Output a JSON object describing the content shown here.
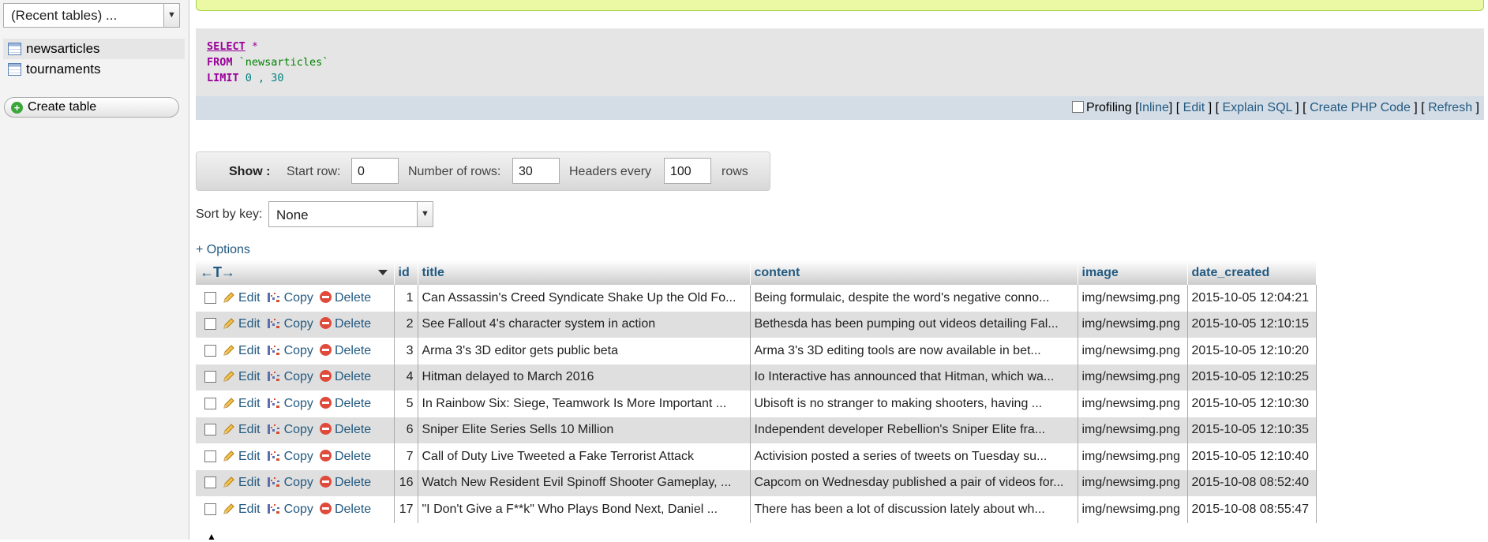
{
  "sidebar": {
    "recent_tables": "(Recent tables) ...",
    "tables": [
      {
        "name": "newsarticles"
      },
      {
        "name": "tournaments"
      }
    ],
    "create_table": "Create table"
  },
  "sql": {
    "select": "SELECT",
    "star": " *",
    "from": "FROM",
    "table": " `newsarticles`",
    "limit": "LIMIT",
    "offset": " 0",
    "sep": " , ",
    "count": "30"
  },
  "sql_actions": {
    "profiling": "Profiling",
    "inline": "Inline",
    "edit": "Edit",
    "explain": "Explain SQL",
    "php": "Create PHP Code",
    "refresh": "Refresh"
  },
  "nav": {
    "show_label": "Show :",
    "start_row_label": "Start row:",
    "start_row_value": "0",
    "num_rows_label": "Number of rows:",
    "num_rows_value": "30",
    "headers_every_label": "Headers every",
    "headers_every_value": "100",
    "rows_label": "rows"
  },
  "sort": {
    "label": "Sort by key:",
    "value": "None"
  },
  "options_link": "+ Options",
  "table": {
    "arrows": "←T→",
    "columns": [
      "id",
      "title",
      "content",
      "image",
      "date_created"
    ],
    "action_labels": {
      "edit": "Edit",
      "copy": "Copy",
      "delete": "Delete"
    },
    "rows": [
      {
        "id": "1",
        "title": "Can Assassin's Creed Syndicate Shake Up the Old Fo...",
        "content": "Being formulaic, despite the word's negative conno...",
        "image": "img/newsimg.png",
        "date_created": "2015-10-05 12:04:21"
      },
      {
        "id": "2",
        "title": "See Fallout 4's character system in action",
        "content": "Bethesda has been pumping out videos detailing Fal...",
        "image": "img/newsimg.png",
        "date_created": "2015-10-05 12:10:15"
      },
      {
        "id": "3",
        "title": "Arma 3's 3D editor gets public beta",
        "content": "Arma 3's 3D editing tools are now available in bet...",
        "image": "img/newsimg.png",
        "date_created": "2015-10-05 12:10:20"
      },
      {
        "id": "4",
        "title": "Hitman delayed to March 2016",
        "content": "Io Interactive has announced that Hitman, which wa...",
        "image": "img/newsimg.png",
        "date_created": "2015-10-05 12:10:25"
      },
      {
        "id": "5",
        "title": "In Rainbow Six: Siege, Teamwork Is More Important ...",
        "content": "Ubisoft is no stranger to making shooters, having ...",
        "image": "img/newsimg.png",
        "date_created": "2015-10-05 12:10:30"
      },
      {
        "id": "6",
        "title": "Sniper Elite Series Sells 10 Million",
        "content": "Independent developer Rebellion's Sniper Elite fra...",
        "image": "img/newsimg.png",
        "date_created": "2015-10-05 12:10:35"
      },
      {
        "id": "7",
        "title": "Call of Duty Live Tweeted a Fake Terrorist Attack",
        "content": "Activision posted a series of tweets on Tuesday su...",
        "image": "img/newsimg.png",
        "date_created": "2015-10-05 12:10:40"
      },
      {
        "id": "16",
        "title": "Watch New Resident Evil Spinoff Shooter Gameplay, ...",
        "content": "Capcom on Wednesday published a pair of videos for...",
        "image": "img/newsimg.png",
        "date_created": "2015-10-08 08:52:40"
      },
      {
        "id": "17",
        "title": "\"I Don't Give a F**k\" Who Plays Bond Next, Daniel ...",
        "content": "There has been a lot of discussion lately about wh...",
        "image": "img/newsimg.png",
        "date_created": "2015-10-08 08:55:47"
      }
    ]
  }
}
